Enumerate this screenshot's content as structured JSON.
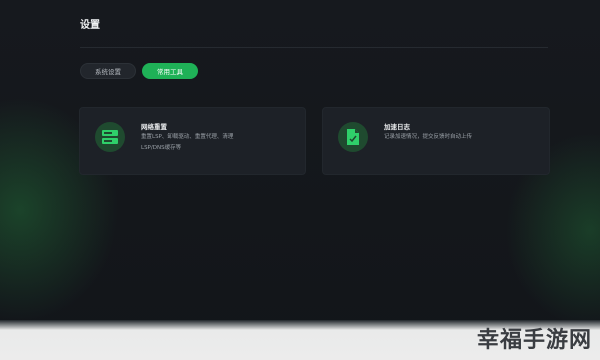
{
  "page": {
    "title": "设置"
  },
  "tabs": [
    {
      "label": "系统设置",
      "active": false
    },
    {
      "label": "常用工具",
      "active": true
    }
  ],
  "cards": [
    {
      "title": "网络重置",
      "description": "重置LSP、卸载驱动、重置代理、清理LSP/DNS缓存等",
      "icon": "server-icon"
    },
    {
      "title": "加速日志",
      "description": "记录加速情况，提交反馈时自动上传",
      "icon": "document-icon"
    }
  ],
  "watermark": "幸福手游网",
  "colors": {
    "accent": "#1fb157",
    "card_bg": "#1d2127",
    "icon_bg": "#1f4a2f"
  }
}
